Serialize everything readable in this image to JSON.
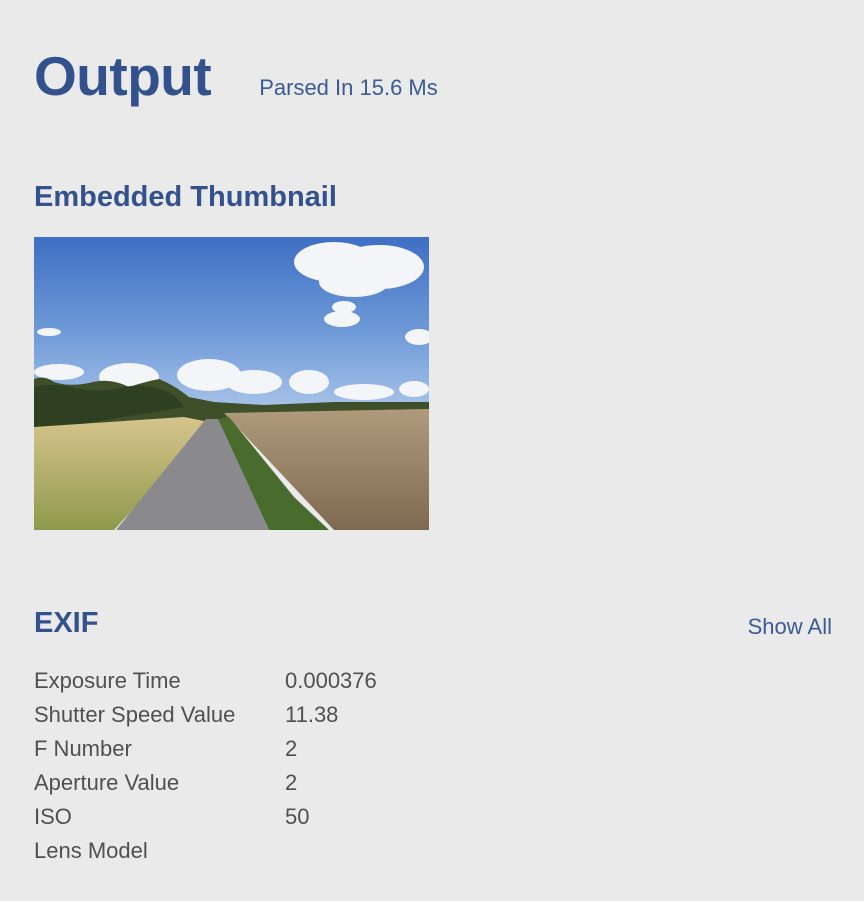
{
  "header": {
    "title": "Output",
    "parse_time": "Parsed In 15.6 Ms"
  },
  "thumbnail": {
    "section_title": "Embedded Thumbnail",
    "image_desc": "photo-landscape"
  },
  "exif": {
    "section_title": "EXIF",
    "show_all_label": "Show All",
    "rows": [
      {
        "key": "Exposure Time",
        "value": "0.000376"
      },
      {
        "key": "Shutter Speed Value",
        "value": "11.38"
      },
      {
        "key": "F Number",
        "value": "2"
      },
      {
        "key": "Aperture Value",
        "value": "2"
      },
      {
        "key": "ISO",
        "value": "50"
      },
      {
        "key": "Lens Model",
        "value": ""
      }
    ]
  },
  "colors": {
    "accent": "#33518c",
    "background": "#eaeaea",
    "text": "#505050"
  }
}
